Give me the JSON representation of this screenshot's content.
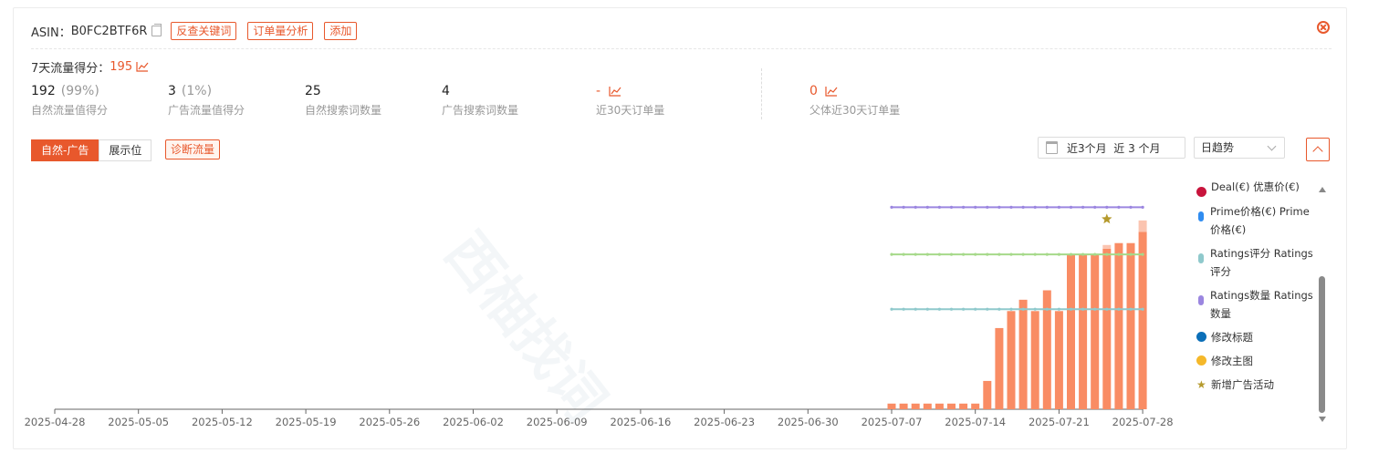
{
  "header": {
    "asin_label": "ASIN：",
    "asin_value": "B0FC2BTF6R",
    "buttons": [
      "反查关键词",
      "订单量分析",
      "添加"
    ]
  },
  "score": {
    "label": "7天流量得分：",
    "value": "195"
  },
  "stats": [
    {
      "value": "192",
      "pct": "(99%)",
      "label": "自然流量值得分"
    },
    {
      "value": "3",
      "pct": "(1%)",
      "label": "广告流量值得分"
    },
    {
      "value": "25",
      "pct": "",
      "label": "自然搜索词数量"
    },
    {
      "value": "4",
      "pct": "",
      "label": "广告搜索词数量"
    },
    {
      "value": "-",
      "pct": "",
      "label": "近30天订单量"
    },
    {
      "value": "0",
      "pct": "",
      "label": "父体近30天订单量"
    }
  ],
  "controls": {
    "tabs": [
      "自然-广告",
      "展示位"
    ],
    "active_tab": "自然-广告",
    "diag_button": "诊断流量",
    "date_range": "近3个月  近 3 个月",
    "trend_select": "日趋势"
  },
  "colors": {
    "accent": "#e8582c",
    "bar": "#f98c64",
    "bar_top": "#fbc4b0",
    "purple": "#9b86e0",
    "green": "#a6d98a",
    "teal": "#8fc9cc",
    "star": "#b59a2d"
  },
  "legend": [
    {
      "color": "#c8143c",
      "shape": "dot",
      "label": "Deal(€)  优惠价(€)"
    },
    {
      "color": "#2f8cf0",
      "shape": "pill",
      "label": "Prime价格(€)  Prime 价格(€)"
    },
    {
      "color": "#8fc9cc",
      "shape": "pill",
      "label": "Ratings评分  Ratings 评分"
    },
    {
      "color": "#9b86e0",
      "shape": "pill",
      "label": "Ratings数量  Ratings 数量"
    },
    {
      "color": "#0b6fb8",
      "shape": "dot",
      "label": "修改标题"
    },
    {
      "color": "#f5b82a",
      "shape": "dot",
      "label": "修改主图"
    },
    {
      "color": "#b59a2d",
      "shape": "star",
      "label": "新增广告活动"
    }
  ],
  "watermark": "西柚找词",
  "chart_data": {
    "type": "bar",
    "x_ticks": [
      "2025-04-28",
      "2025-05-05",
      "2025-05-12",
      "2025-05-19",
      "2025-05-26",
      "2025-06-02",
      "2025-06-09",
      "2025-06-16",
      "2025-06-23",
      "2025-06-30",
      "2025-07-07",
      "2025-07-14",
      "2025-07-21",
      "2025-07-28"
    ],
    "bar_dates": [
      "2025-07-07",
      "2025-07-08",
      "2025-07-09",
      "2025-07-10",
      "2025-07-11",
      "2025-07-12",
      "2025-07-13",
      "2025-07-14",
      "2025-07-15",
      "2025-07-16",
      "2025-07-17",
      "2025-07-18",
      "2025-07-19",
      "2025-07-20",
      "2025-07-21",
      "2025-07-22",
      "2025-07-23",
      "2025-07-24",
      "2025-07-25",
      "2025-07-26",
      "2025-07-27",
      "2025-07-28"
    ],
    "bars_main": [
      3,
      3,
      3,
      3,
      3,
      3,
      3,
      3,
      15,
      43,
      52,
      58,
      52,
      63,
      52,
      82,
      82,
      82,
      85,
      88,
      88,
      94
    ],
    "bars_extra": [
      0,
      0,
      0,
      0,
      0,
      0,
      0,
      0,
      0,
      0,
      0,
      0,
      0,
      0,
      0,
      0,
      0,
      0,
      2,
      0,
      0,
      6
    ],
    "ratings_count_line": 107,
    "prime_line": 82,
    "ratings_score_line": 53,
    "star_event_date": "2025-07-25",
    "ylim": [
      0,
      112
    ]
  }
}
